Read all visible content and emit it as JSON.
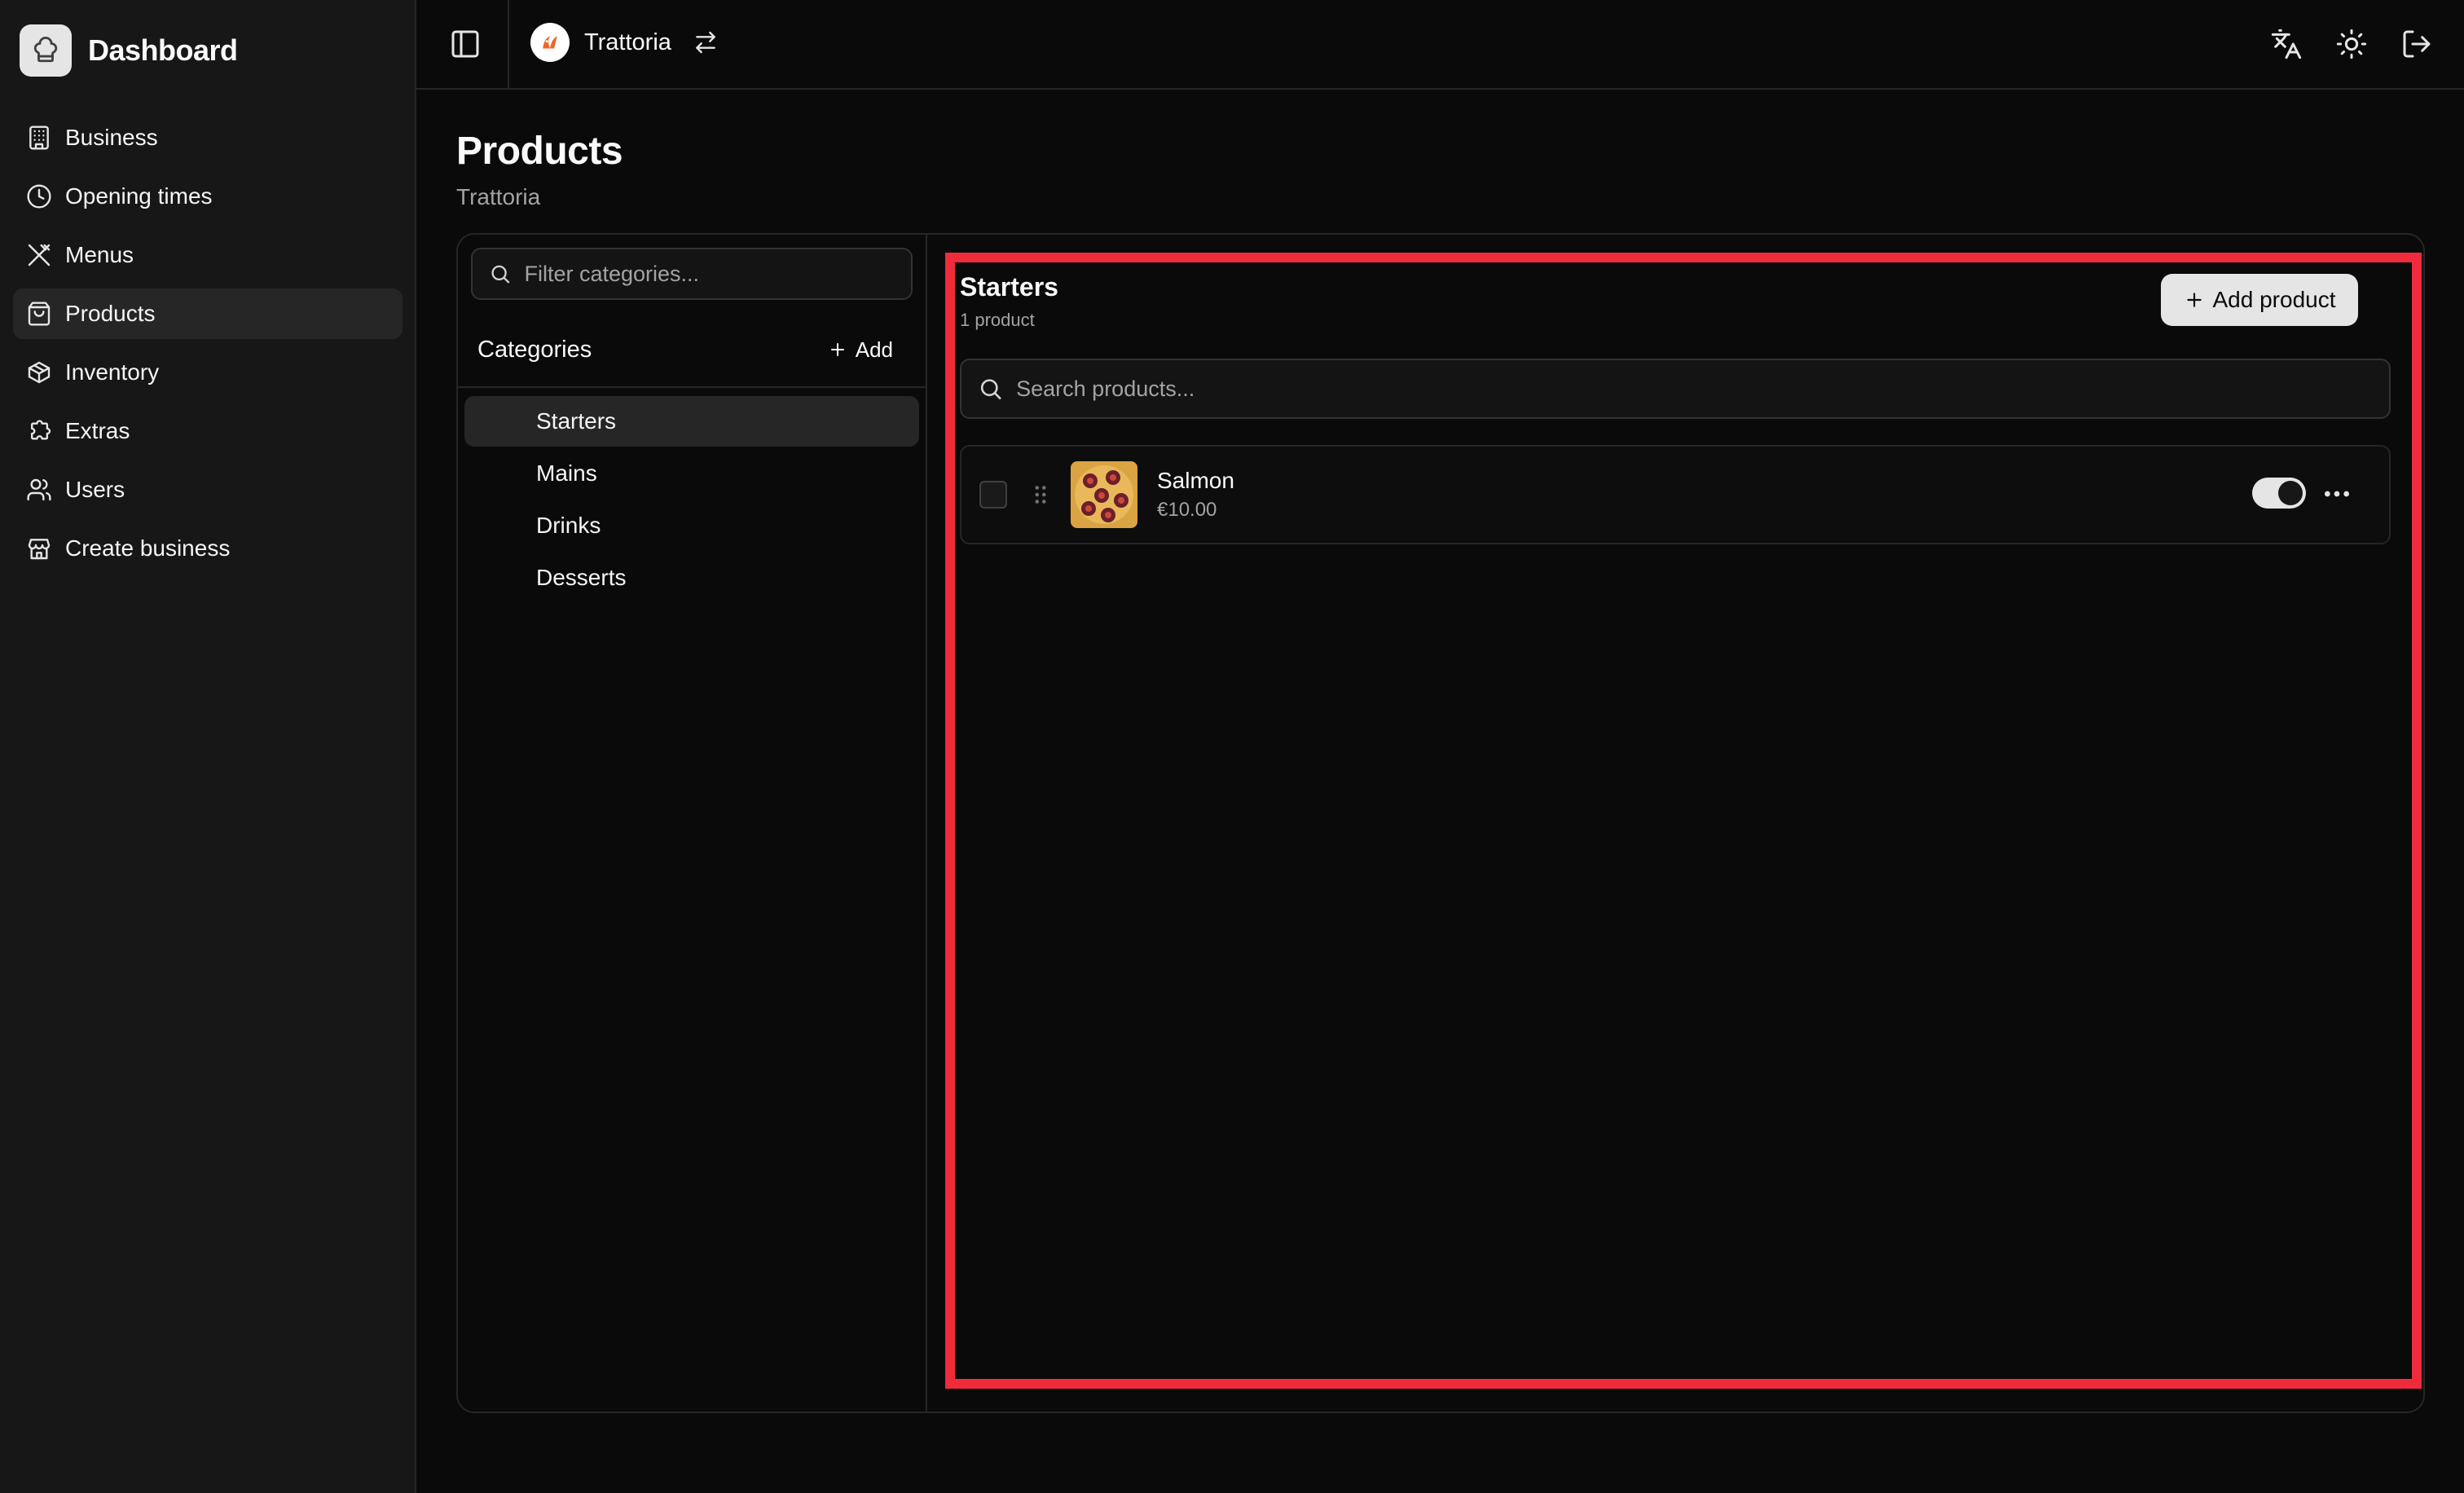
{
  "sidebar": {
    "brand_title": "Dashboard",
    "items": [
      {
        "label": "Business",
        "icon": "building-icon"
      },
      {
        "label": "Opening times",
        "icon": "clock-icon"
      },
      {
        "label": "Menus",
        "icon": "utensils-icon"
      },
      {
        "label": "Products",
        "icon": "shopping-bag-icon",
        "active": true
      },
      {
        "label": "Inventory",
        "icon": "package-icon"
      },
      {
        "label": "Extras",
        "icon": "puzzle-icon"
      },
      {
        "label": "Users",
        "icon": "users-icon"
      },
      {
        "label": "Create business",
        "icon": "store-icon"
      }
    ]
  },
  "topbar": {
    "business_name": "Trattoria",
    "right_icons": [
      "translate-icon",
      "sun-icon",
      "logout-icon"
    ]
  },
  "page": {
    "title": "Products",
    "subtitle": "Trattoria"
  },
  "categories": {
    "filter_placeholder": "Filter categories...",
    "header": "Categories",
    "add_label": "Add",
    "items": [
      "Starters",
      "Mains",
      "Drinks",
      "Desserts"
    ],
    "selected": "Starters"
  },
  "products_panel": {
    "category_title": "Starters",
    "count_text": "1 product",
    "add_label": "Add product",
    "search_placeholder": "Search products...",
    "items": [
      {
        "name": "Salmon",
        "price": "€10.00",
        "enabled": true
      }
    ]
  },
  "colors": {
    "background": "#0a0a0a",
    "sidebar": "#171717",
    "highlight": "#ef2b3c",
    "brand_accent": "#f0642a"
  }
}
